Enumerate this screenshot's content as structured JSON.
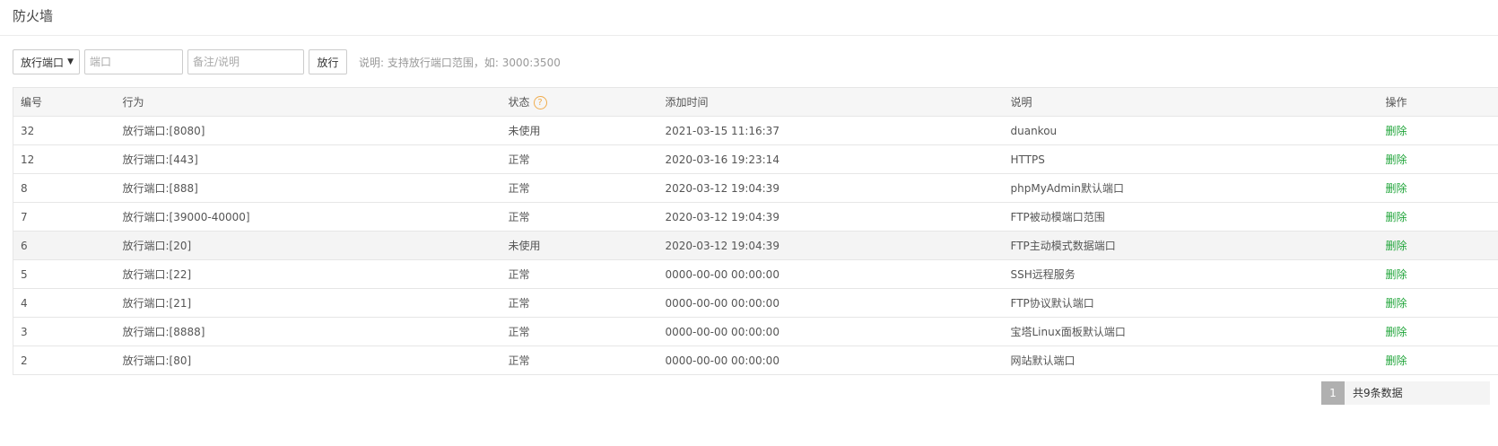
{
  "page": {
    "title": "防火墙"
  },
  "toolbar": {
    "select_value": "放行端口",
    "port_placeholder": "端口",
    "note_placeholder": "备注/说明",
    "submit_label": "放行",
    "hint": "说明: 支持放行端口范围，如: 3000:3500"
  },
  "table": {
    "columns": {
      "id": "编号",
      "action": "行为",
      "status": "状态",
      "time": "添加时间",
      "note": "说明",
      "op": "操作"
    },
    "help_symbol": "?",
    "rows": [
      {
        "id": "32",
        "action": "放行端口:[8080]",
        "status": "未使用",
        "time": "2021-03-15 11:16:37",
        "note": "duankou",
        "op": "删除"
      },
      {
        "id": "12",
        "action": "放行端口:[443]",
        "status": "正常",
        "time": "2020-03-16 19:23:14",
        "note": "HTTPS",
        "op": "删除"
      },
      {
        "id": "8",
        "action": "放行端口:[888]",
        "status": "正常",
        "time": "2020-03-12 19:04:39",
        "note": "phpMyAdmin默认端口",
        "op": "删除"
      },
      {
        "id": "7",
        "action": "放行端口:[39000-40000]",
        "status": "正常",
        "time": "2020-03-12 19:04:39",
        "note": "FTP被动模端口范围",
        "op": "删除"
      },
      {
        "id": "6",
        "action": "放行端口:[20]",
        "status": "未使用",
        "time": "2020-03-12 19:04:39",
        "note": "FTP主动模式数据端口",
        "op": "删除"
      },
      {
        "id": "5",
        "action": "放行端口:[22]",
        "status": "正常",
        "time": "0000-00-00 00:00:00",
        "note": "SSH远程服务",
        "op": "删除"
      },
      {
        "id": "4",
        "action": "放行端口:[21]",
        "status": "正常",
        "time": "0000-00-00 00:00:00",
        "note": "FTP协议默认端口",
        "op": "删除"
      },
      {
        "id": "3",
        "action": "放行端口:[8888]",
        "status": "正常",
        "time": "0000-00-00 00:00:00",
        "note": "宝塔Linux面板默认端口",
        "op": "删除"
      },
      {
        "id": "2",
        "action": "放行端口:[80]",
        "status": "正常",
        "time": "0000-00-00 00:00:00",
        "note": "网站默认端口",
        "op": "删除"
      }
    ]
  },
  "pagination": {
    "current": "1",
    "total_text": "共9条数据"
  },
  "colors": {
    "accent_green": "#20a53a",
    "help_orange": "#f0ad4e",
    "page_active": "#b0b0b0"
  }
}
